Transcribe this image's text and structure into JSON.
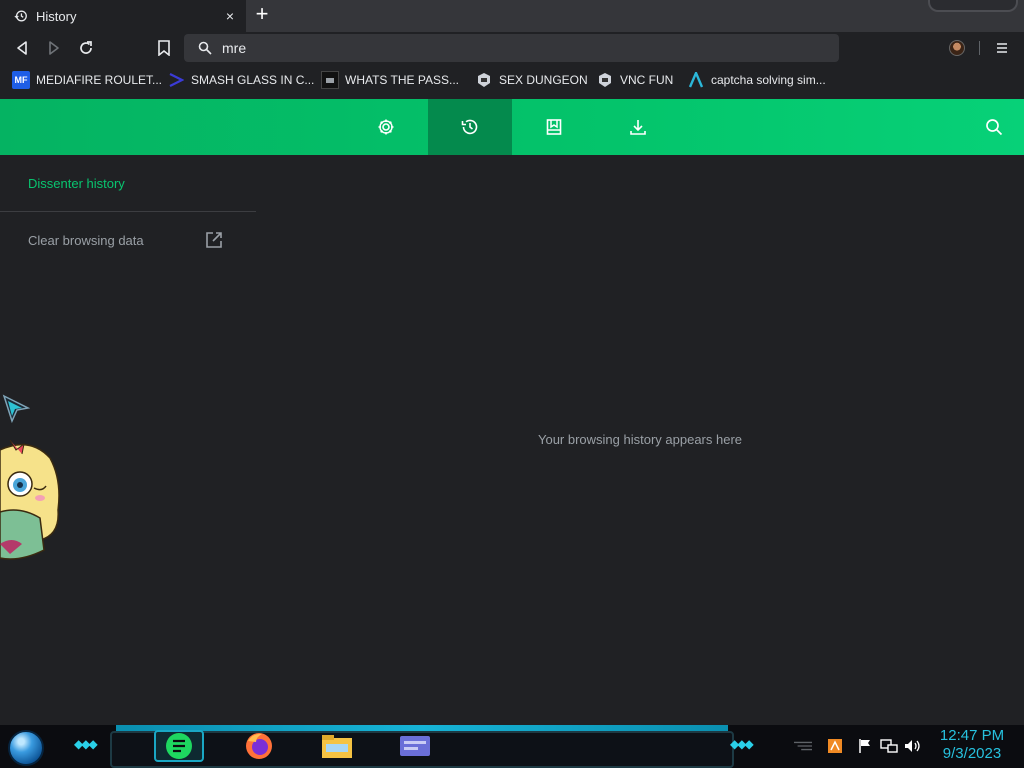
{
  "tab": {
    "title": "History",
    "close": "×",
    "new": "+"
  },
  "omnibox": {
    "text": "mre"
  },
  "bookmarks": [
    {
      "label": "MEDIAFIRE ROULET...",
      "icon": "mediafire-icon",
      "color": "#1f5ee6"
    },
    {
      "label": "SMASH GLASS IN C...",
      "icon": "smash-glass-icon",
      "color": "#3b3bd6"
    },
    {
      "label": "WHATS THE PASS...",
      "icon": "password-site-icon",
      "color": "#111111"
    },
    {
      "label": "SEX DUNGEON",
      "icon": "dungeon-icon",
      "color": "#cfd3da"
    },
    {
      "label": "VNC FUN",
      "icon": "vnc-icon",
      "color": "#cfd3da"
    },
    {
      "label": "captcha solving sim...",
      "icon": "captcha-icon",
      "color": "#2bb7d9"
    }
  ],
  "header": {
    "buttons": [
      "settings-icon",
      "history-icon",
      "bookmarks-icon",
      "downloads-icon",
      "search-icon"
    ],
    "active": "history-icon",
    "accent": "#04c46b",
    "active_bg": "#048a4d"
  },
  "sidebar": {
    "title": "Dissenter history",
    "clear_label": "Clear browsing data"
  },
  "main": {
    "empty_message": "Your browsing history appears here"
  },
  "taskbar": {
    "apps": [
      "notes-app-icon",
      "firefox-icon",
      "file-explorer-icon",
      "media-app-icon"
    ],
    "active_app": "notes-app-icon",
    "tray": [
      "network-tray-icon",
      "flag-tray-icon",
      "display-tray-icon",
      "volume-tray-icon"
    ],
    "time": "12:47 PM",
    "date": "9/3/2023"
  }
}
